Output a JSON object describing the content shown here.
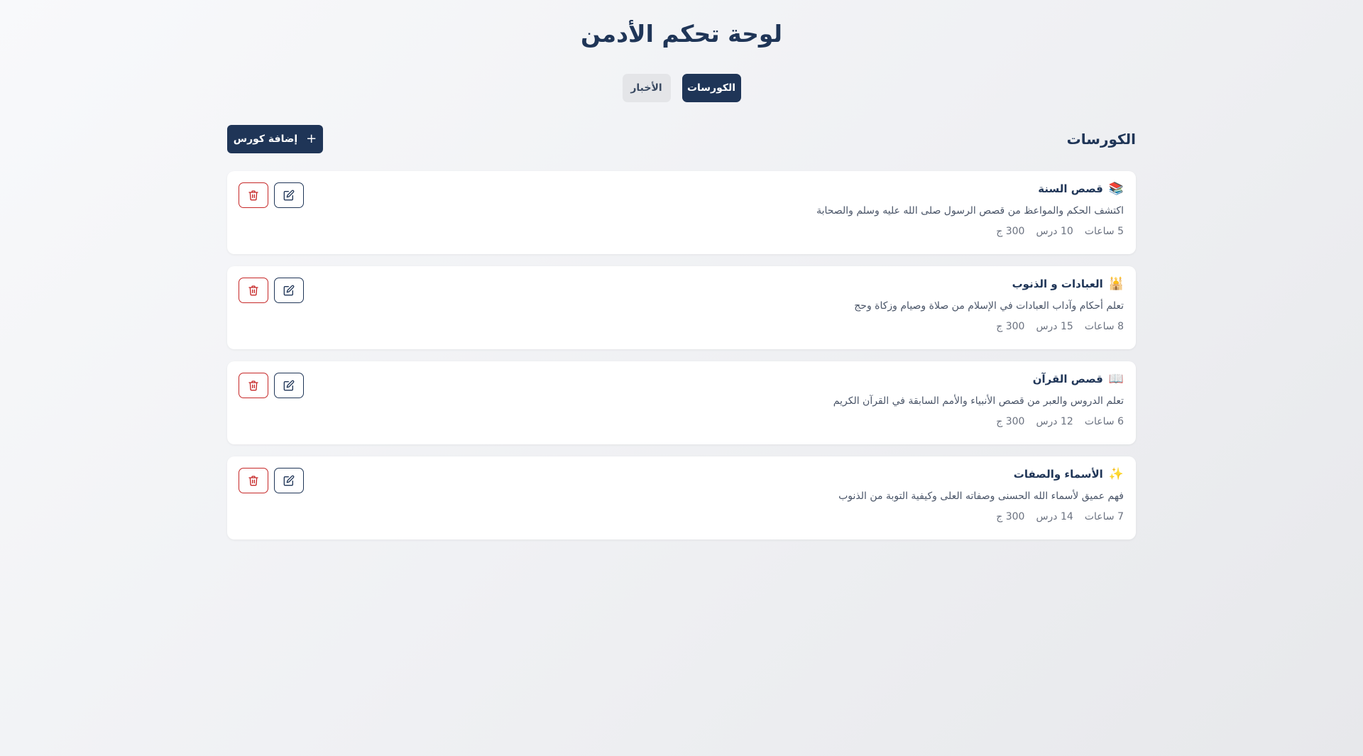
{
  "page": {
    "title": "لوحة تحكم الأدمن"
  },
  "tabs": [
    {
      "label": "الكورسات",
      "active": true
    },
    {
      "label": "الأخبار",
      "active": false
    }
  ],
  "section": {
    "title": "الكورسات",
    "add_button_label": "إضافة كورس",
    "add_button_icon": "plus-icon"
  },
  "colors": {
    "primary": "#1f3557",
    "danger": "#c62828",
    "card_bg": "#ffffff"
  },
  "courses": [
    {
      "emoji": "📚",
      "title": "قصص السنة",
      "description": "اكتشف الحكم والمواعظ من قصص الرسول صلى الله عليه وسلم والصحابة",
      "hours": "5 ساعات",
      "lessons": "10 درس",
      "price": "300 ج"
    },
    {
      "emoji": "🕌",
      "title": "العبادات و الذنوب",
      "description": "تعلم أحكام وآداب العبادات في الإسلام من صلاة وصيام وزكاة وحج",
      "hours": "8 ساعات",
      "lessons": "15 درس",
      "price": "300 ج"
    },
    {
      "emoji": "📖",
      "title": "قصص القرآن",
      "description": "تعلم الدروس والعبر من قصص الأنبياء والأمم السابقة في القرآن الكريم",
      "hours": "6 ساعات",
      "lessons": "12 درس",
      "price": "300 ج"
    },
    {
      "emoji": "✨",
      "title": "الأسماء والصفات",
      "description": "فهم عميق لأسماء الله الحسنى وصفاته العلى وكيفية التوبة من الذنوب",
      "hours": "7 ساعات",
      "lessons": "14 درس",
      "price": "300 ج"
    }
  ],
  "card_actions": {
    "edit_icon": "edit-icon",
    "delete_icon": "trash-icon"
  }
}
